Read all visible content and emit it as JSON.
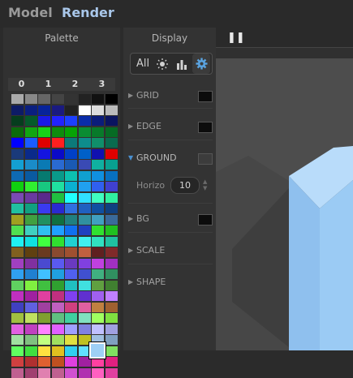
{
  "tabs": {
    "model": "Model",
    "render": "Render"
  },
  "palette": {
    "title": "Palette",
    "columns": [
      "0",
      "1",
      "2",
      "3"
    ],
    "selected_color": "#9ed0f5"
  },
  "display": {
    "title": "Display",
    "tabs": {
      "all": "All",
      "lighting_icon": "sun-icon",
      "stats_icon": "bar-chart-icon",
      "settings_icon": "gear-icon"
    },
    "rows": [
      {
        "label": "GRID",
        "color": "#0c0c0c",
        "expanded": false
      },
      {
        "label": "EDGE",
        "color": "#0c0c0c",
        "expanded": false
      },
      {
        "label": "GROUND",
        "color": "#3c3c3c",
        "expanded": true
      },
      {
        "label": "BG",
        "color": "#0c0c0c",
        "expanded": false
      },
      {
        "label": "SCALE",
        "expanded": false
      },
      {
        "label": "SHAPE",
        "expanded": false
      }
    ],
    "ground": {
      "horizon_label": "Horizo",
      "horizon_value": "10"
    }
  },
  "viewport": {
    "pause_icon": "pause-icon",
    "pause_glyph": "❚❚"
  }
}
